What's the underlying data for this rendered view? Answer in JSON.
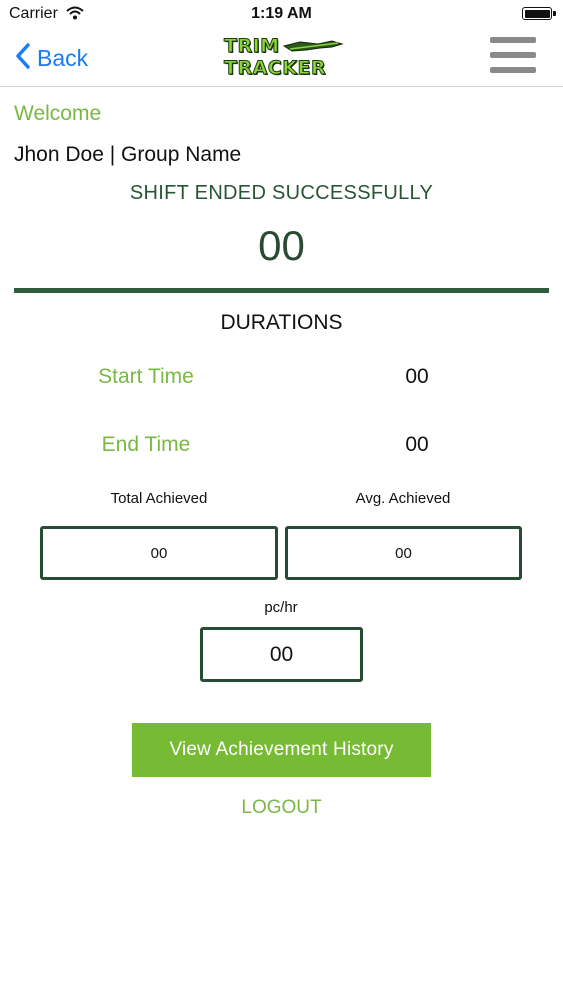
{
  "status_bar": {
    "carrier": "Carrier",
    "time": "1:19 AM"
  },
  "nav": {
    "back_label": "Back",
    "logo_line1": "TRIM",
    "logo_line2": "TRACKER"
  },
  "header": {
    "welcome": "Welcome",
    "user_line": "Jhon Doe | Group Name",
    "shift_message": "SHIFT ENDED SUCCESSFULLY",
    "count": "00"
  },
  "durations": {
    "title": "DURATIONS",
    "start_label": "Start Time",
    "start_value": "00",
    "end_label": "End Time",
    "end_value": "00"
  },
  "stats": {
    "total_label": "Total Achieved",
    "total_value": "00",
    "avg_label": "Avg. Achieved",
    "avg_value": "00",
    "rate_label": "pc/hr",
    "rate_value": "00"
  },
  "actions": {
    "history_label": "View Achievement History",
    "logout_label": "LOGOUT"
  },
  "colors": {
    "accent_green": "#77bb35",
    "dark_green": "#2e5d3d",
    "ios_blue": "#1a7cf2"
  },
  "icons": [
    "wifi-icon",
    "battery-icon",
    "back-chevron-icon",
    "hamburger-menu-icon",
    "trim-tracker-logo"
  ]
}
